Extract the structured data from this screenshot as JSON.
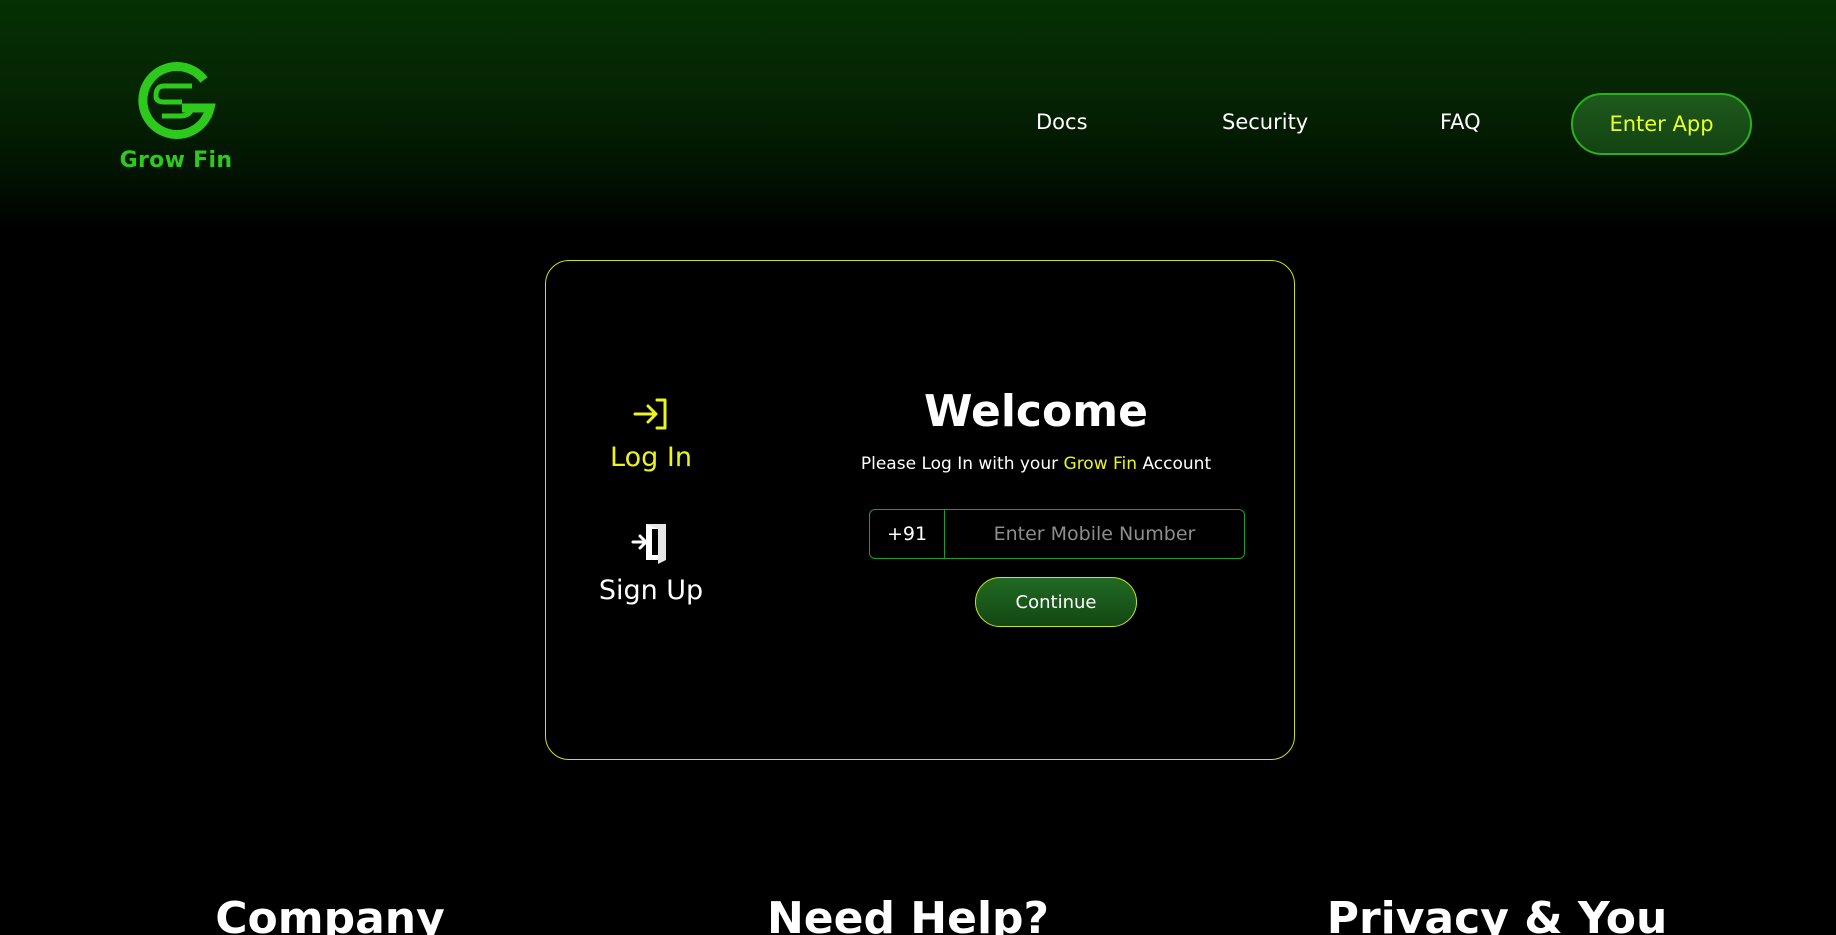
{
  "brand": {
    "name": "Grow Fin",
    "logo_icon": "growfin-logo-icon",
    "color": "#2ec91d"
  },
  "nav": {
    "docs": "Docs",
    "security": "Security",
    "faq": "FAQ",
    "enter_app": "Enter App"
  },
  "auth": {
    "login_label": "Log In",
    "login_icon": "login-arrow-icon",
    "signup_label": "Sign Up",
    "signup_icon": "door-enter-icon",
    "title": "Welcome",
    "subtitle_prefix": "Please Log In with your ",
    "subtitle_brand": "Grow Fin",
    "subtitle_suffix": " Account",
    "country_code": "+91",
    "phone_placeholder": "Enter Mobile Number",
    "phone_value": "",
    "continue_label": "Continue"
  },
  "footer": {
    "company": "Company",
    "help": "Need Help?",
    "privacy": "Privacy & You"
  },
  "colors": {
    "accent_yellow": "#ebf51c",
    "accent_green": "#2ec91d",
    "card_border": "#c7e21b"
  }
}
